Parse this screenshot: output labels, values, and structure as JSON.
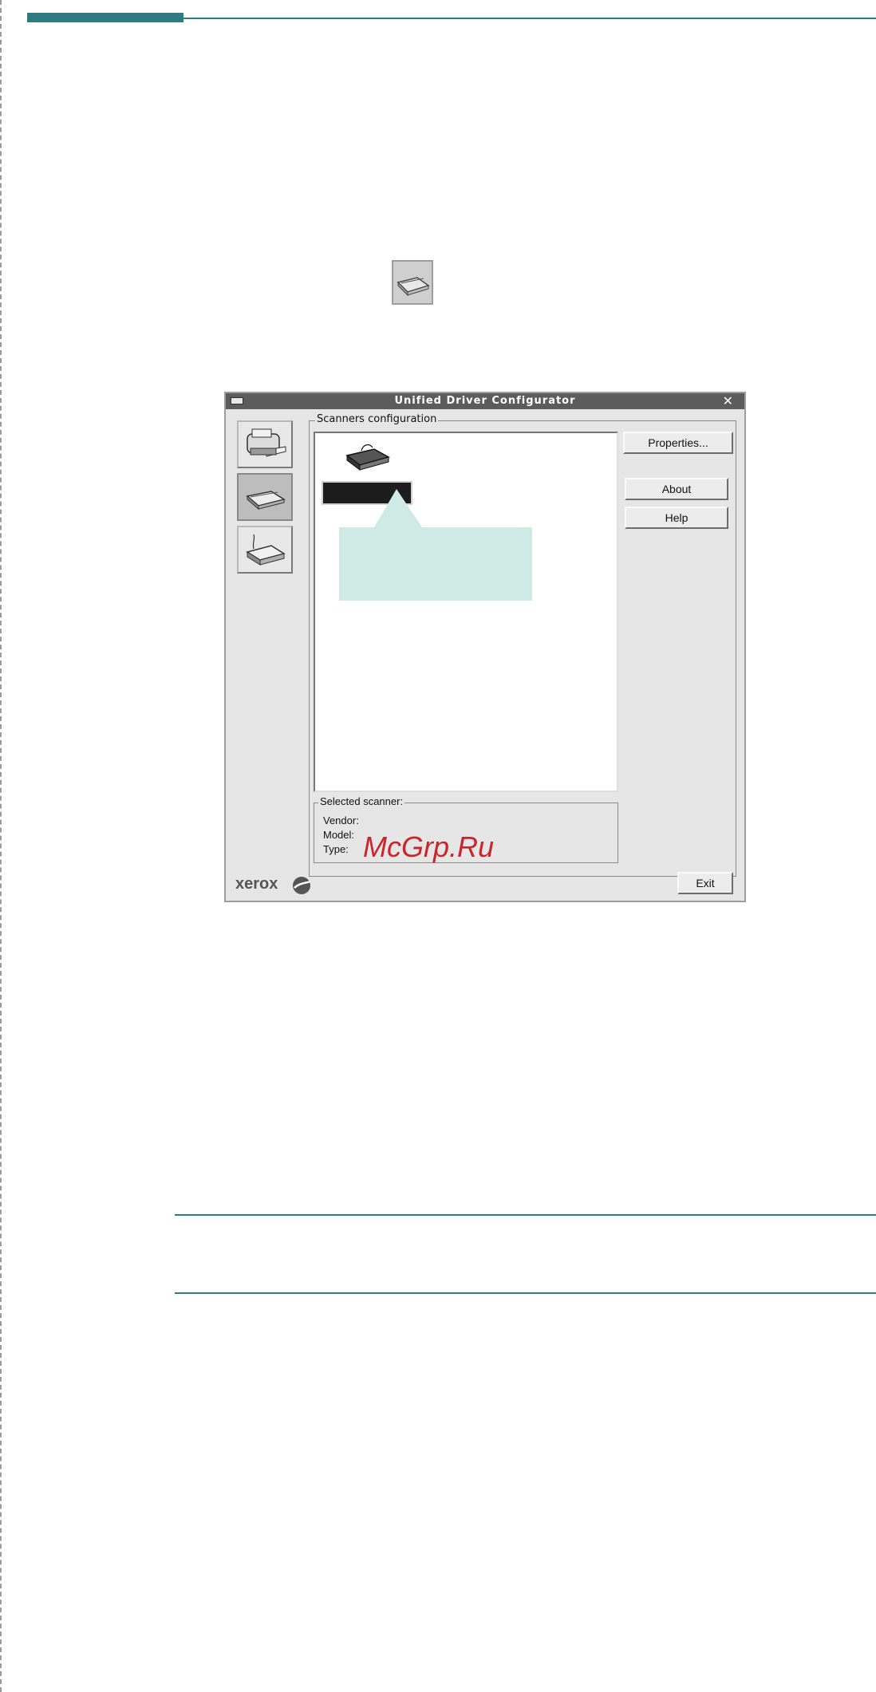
{
  "window": {
    "title": "Unified Driver Configurator",
    "group_label": "Scanners configuration",
    "buttons": {
      "properties": "Properties...",
      "about": "About",
      "help": "Help",
      "exit": "Exit"
    },
    "selected_scanner": {
      "legend": "Selected scanner:",
      "vendor_label": "Vendor:",
      "model_label": "Model:",
      "type_label": "Type:"
    },
    "logo_text": "xerox",
    "watermark": "McGrp.Ru"
  },
  "icons": {
    "toolbar_scanner": "scanner-icon",
    "sidebar": [
      "printer-icon",
      "scanner-icon",
      "port-icon"
    ],
    "list_item": "scanner-icon"
  },
  "colors": {
    "accent": "#2e7b81",
    "callout": "#cfeae5",
    "watermark": "#c8262c",
    "titlebar": "#5c5c5c"
  }
}
